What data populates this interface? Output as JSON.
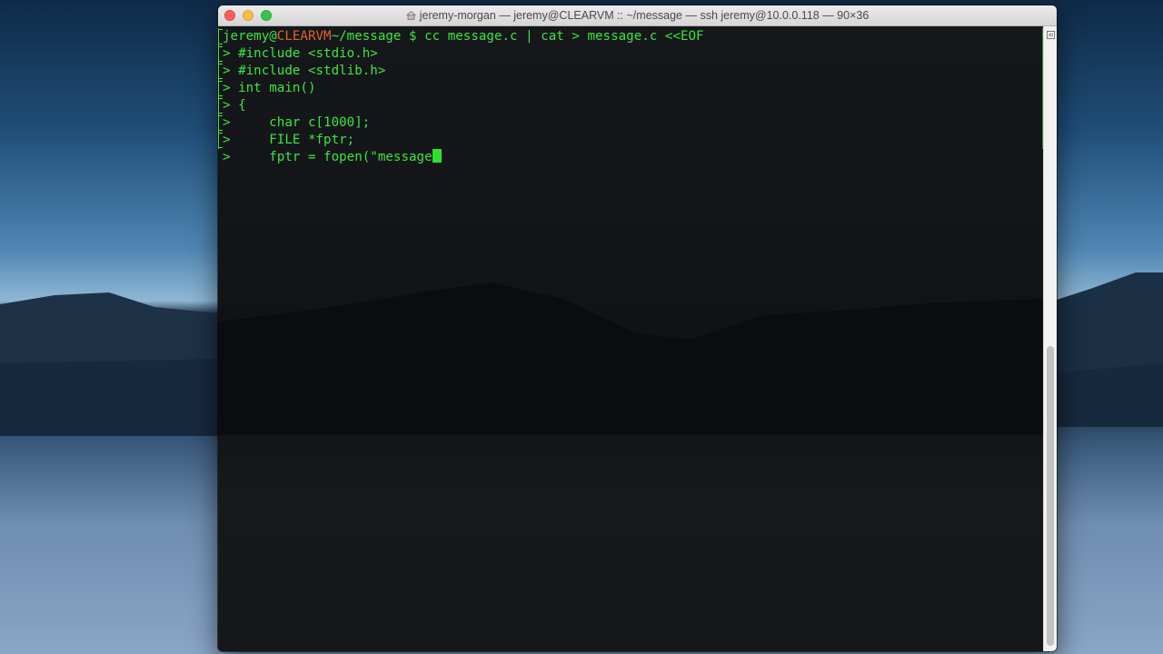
{
  "window": {
    "title": "jeremy-morgan — jeremy@CLEARVM :: ~/message — ssh jeremy@10.0.0.118 — 90×36",
    "title_icon": "home-folder-icon"
  },
  "terminal": {
    "prompt": {
      "user": "jeremy@",
      "host": "CLEARVM",
      "path": "~/message",
      "symbol": " $ ",
      "command": "cc message.c | cat > message.c <<EOF"
    },
    "continuation_prefix": "> ",
    "heredoc_lines": [
      "#include <stdio.h>",
      "#include <stdlib.h>",
      "int main()",
      "{",
      "    char c[1000];",
      "    FILE *fptr;",
      "    fptr = fopen(\"message"
    ],
    "colors": {
      "text": "#3ce63c",
      "host": "#e2622a",
      "cursor": "#2ee02e"
    }
  }
}
